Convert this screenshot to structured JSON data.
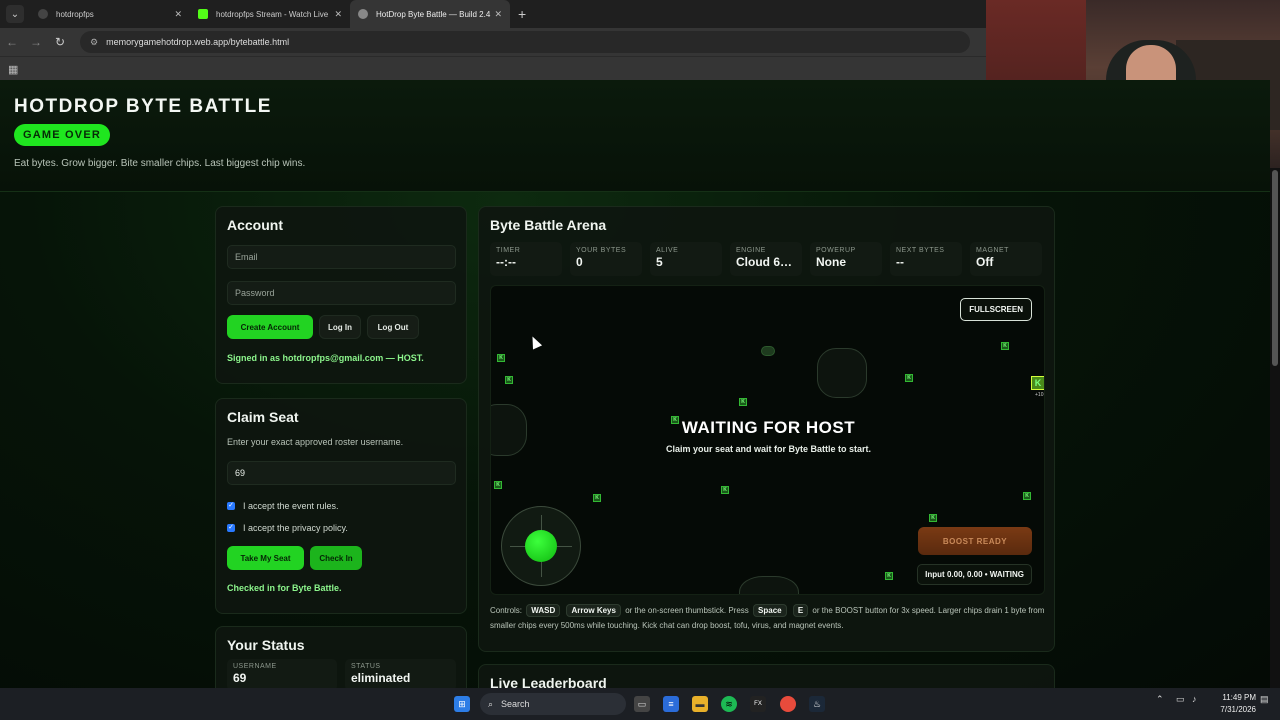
{
  "browser": {
    "tabs": [
      {
        "label": "hotdropfps",
        "active": false
      },
      {
        "label": "hotdropfps Stream - Watch Live",
        "active": false
      },
      {
        "label": "HotDrop Byte Battle — Build 2.4",
        "active": true
      }
    ],
    "url": "memorygamehotdrop.web.app/bytebattle.html"
  },
  "header": {
    "title": "HOTDROP BYTE BATTLE",
    "badge": "GAME OVER",
    "tagline": "Eat bytes. Grow bigger. Bite smaller chips. Last biggest chip wins."
  },
  "account": {
    "heading": "Account",
    "email_placeholder": "Email",
    "password_placeholder": "Password",
    "create_label": "Create Account",
    "login_label": "Log In",
    "logout_label": "Log Out",
    "signed_in": "Signed in as hotdropfps@gmail.com — HOST."
  },
  "claim": {
    "heading": "Claim Seat",
    "instructions": "Enter your exact approved roster username.",
    "username_value": "69",
    "rules_label": "I accept the event rules.",
    "privacy_label": "I accept the privacy policy.",
    "take_seat_label": "Take My Seat",
    "checkin_label": "Check In",
    "status_msg": "Checked in for Byte Battle."
  },
  "your_status": {
    "heading": "Your Status",
    "username_label": "USERNAME",
    "username_value": "69",
    "status_label": "STATUS",
    "status_value": "eliminated"
  },
  "arena": {
    "heading": "Byte Battle Arena",
    "stats": [
      {
        "label": "TIMER",
        "value": "--:--"
      },
      {
        "label": "YOUR BYTES",
        "value": "0"
      },
      {
        "label": "ALIVE",
        "value": "5"
      },
      {
        "label": "ENGINE",
        "value": "Cloud 6…"
      },
      {
        "label": "POWERUP",
        "value": "None"
      },
      {
        "label": "NEXT BYTES",
        "value": "--"
      },
      {
        "label": "MAGNET",
        "value": "Off"
      }
    ],
    "fullscreen_label": "FULLSCREEN",
    "overlay_title": "WAITING FOR HOST",
    "overlay_sub": "Claim your seat and wait for Byte Battle to start.",
    "boost_label": "BOOST READY",
    "input_readout": "Input 0.00, 0.00 • WAITING",
    "byte_glyph": "K",
    "bonus_text": "+10"
  },
  "controls": {
    "prefix": "Controls:",
    "key_wasd": "WASD",
    "key_arrows": "Arrow Keys",
    "mid1": "or the on-screen thumbstick. Press",
    "key_space": "Space",
    "key_e": "E",
    "rest": "or the BOOST button for 3x speed. Larger chips drain 1 byte from smaller chips every 500ms while touching. Kick chat can drop boost, tofu, virus, and magnet events."
  },
  "leaderboard": {
    "heading": "Live Leaderboard"
  },
  "taskbar": {
    "search_label": "Search",
    "time": "11:49 PM",
    "date": "7/31/2026"
  },
  "colors": {
    "accent": "#22d322",
    "background": "#061408",
    "success_text": "#8cf58c",
    "boost": "#7a3a14"
  }
}
